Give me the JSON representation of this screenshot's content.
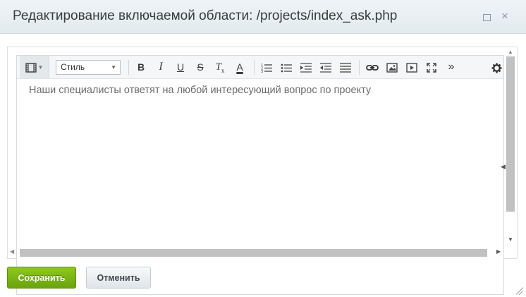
{
  "window": {
    "title": "Редактирование включаемой области: /projects/index_ask.php",
    "maximize_icon": "maximize-icon",
    "close_glyph": "×"
  },
  "toolbar": {
    "mode_icon": "film-icon",
    "style_select": {
      "selected": "Стиль"
    },
    "tools": {
      "bold": "B",
      "italic": "I",
      "underline": "U",
      "strike": "S",
      "clear_format": "T",
      "clear_format_sub": "x",
      "font_color": "A",
      "more": "»"
    },
    "icons": [
      "ordered-list-icon",
      "bullet-list-icon",
      "indent-icon",
      "outdent-icon",
      "align-justify-icon",
      "link-icon",
      "image-icon",
      "video-icon",
      "fullscreen-icon",
      "more-icon",
      "settings-gear-icon"
    ]
  },
  "editor": {
    "content": "Наши специалисты ответят на любой интересующий вопрос по проекту"
  },
  "buttons": {
    "save": "Сохранить",
    "cancel": "Отменить"
  },
  "colors": {
    "save_green": "#7ab414",
    "titlebar": "#e8eef1"
  }
}
